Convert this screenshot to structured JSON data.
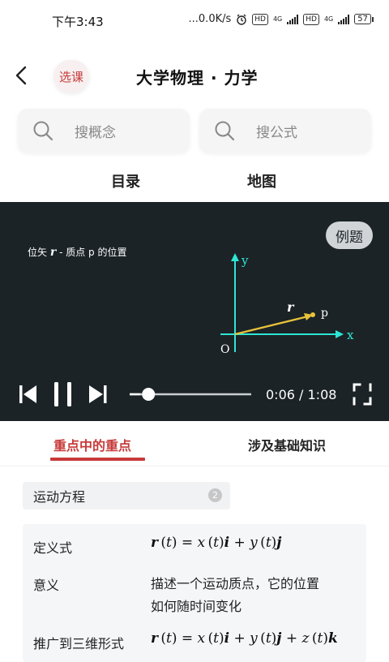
{
  "status_bar": {
    "time": "下午3:43",
    "network_speed": "...0.0K/s",
    "hd1": "HD",
    "sig1": "4G",
    "hd2": "HD",
    "sig2": "4G",
    "battery": "57",
    "icons": [
      "alarm-icon",
      "signal-icon",
      "battery-icon"
    ]
  },
  "header": {
    "back_icon": "chevron-left-icon",
    "select_course_label": "选课",
    "title": "大学物理 · 力学"
  },
  "search": {
    "concept_placeholder": "搜概念",
    "formula_placeholder": "搜公式",
    "icon": "search-icon"
  },
  "nav": {
    "catalog": "目录",
    "map": "地图"
  },
  "video": {
    "example_button": "例题",
    "caption_prefix": "位矢",
    "caption_symbol": "r",
    "caption_suffix": "-  质点 p 的位置",
    "diagram": {
      "x_label": "x",
      "y_label": "y",
      "origin_label": "O",
      "vector_label": "r",
      "point_label": "p"
    },
    "time_display": "0:06 / 1:08",
    "progress": 0.088,
    "controls": [
      "skip-back-icon",
      "pause-icon",
      "skip-forward-icon",
      "fullscreen-icon"
    ]
  },
  "tabs": {
    "key_points": "重点中的重点",
    "basics": "涉及基础知识"
  },
  "section": {
    "title": "运动方程",
    "count": "2"
  },
  "formula_card": {
    "definition_label": "定义式",
    "meaning_label": "意义",
    "meaning_line1": "描述一个运动质点，它的位置",
    "meaning_line2": "如何随时间变化",
    "three_d_label": "推广到三维形式"
  },
  "colors": {
    "accent": "#c73a3a",
    "video_bg": "#1b2326",
    "axis": "#2ee6d6",
    "vector": "#e8c33a"
  }
}
